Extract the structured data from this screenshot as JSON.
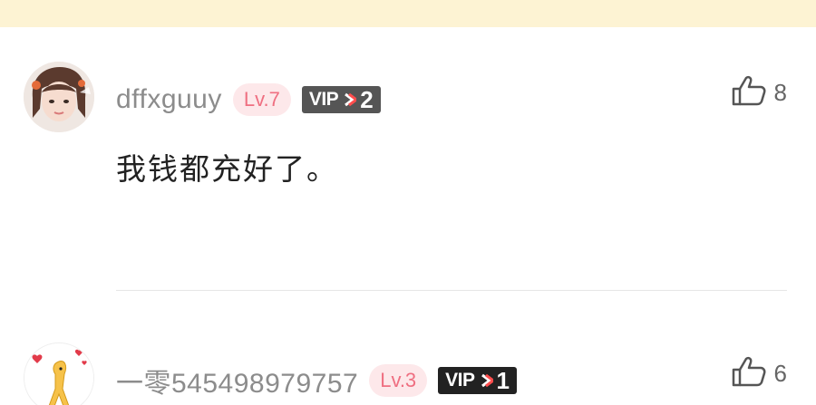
{
  "comments": [
    {
      "username": "dffxguuy",
      "level": "Lv.7",
      "vip_prefix": "VIP",
      "vip_level": "2",
      "like_count": "8",
      "text": "我钱都充好了。"
    },
    {
      "username": "一零545498979757",
      "level": "Lv.3",
      "vip_prefix": "VIP",
      "vip_level": "1",
      "like_count": "6"
    }
  ],
  "colors": {
    "banner": "#fdf3d3",
    "level_badge_bg": "#fde8ea",
    "level_badge_text": "#ef6f81",
    "vip_badge_1": "#555555",
    "vip_badge_2": "#222222",
    "vip_arrow": "#ff4d4d",
    "username": "#8c8c8c"
  },
  "icons": {
    "like": "thumbs-up-outline-icon",
    "vip_arrow": "chevron-right-icon"
  }
}
